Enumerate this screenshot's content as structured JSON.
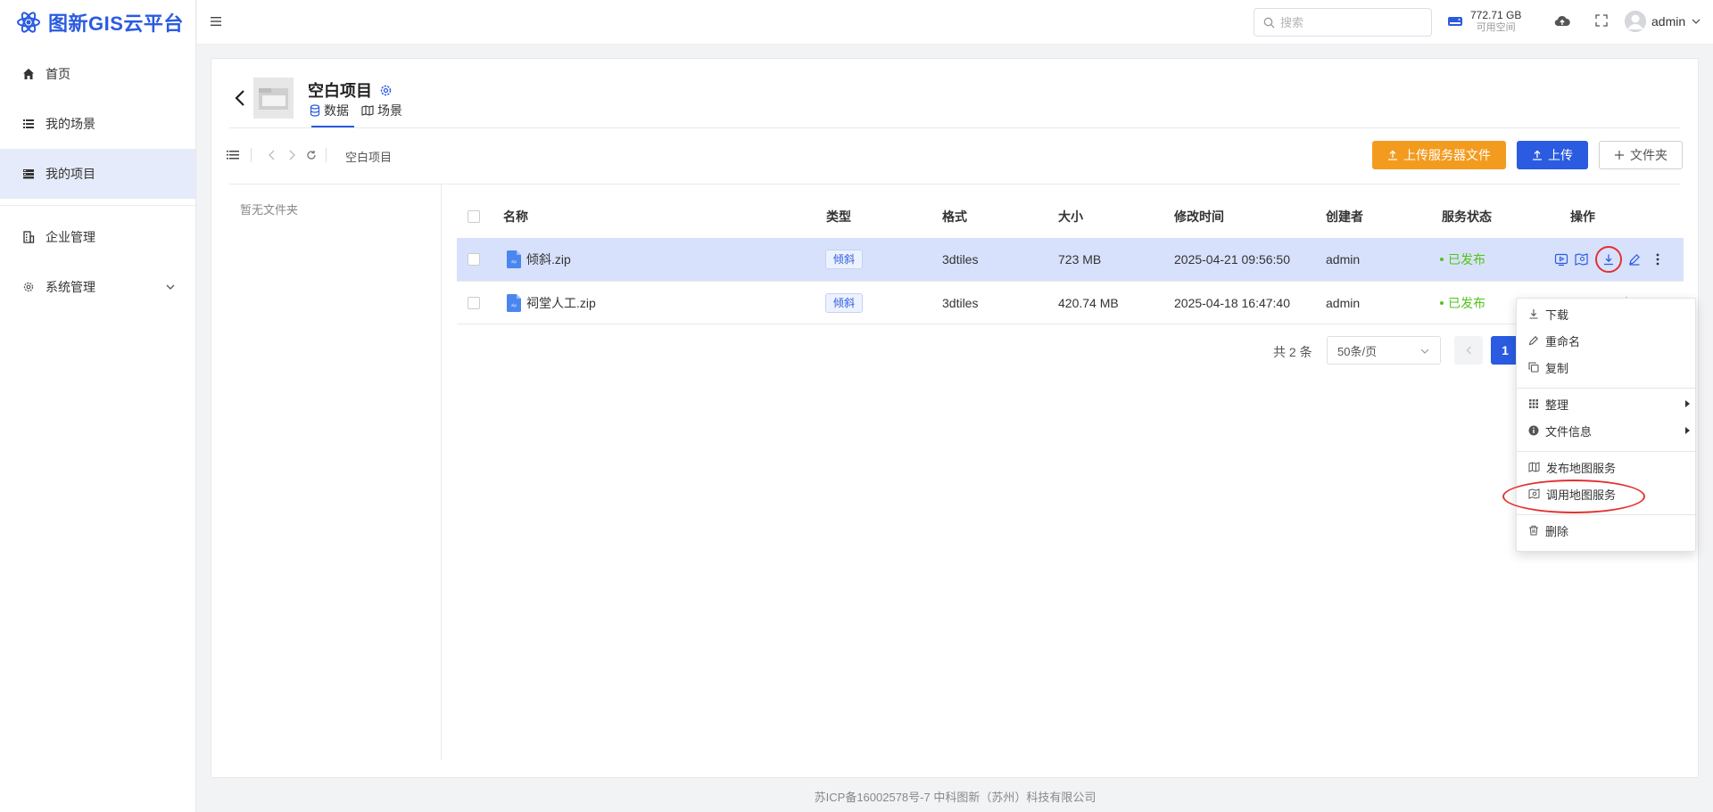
{
  "app": {
    "title": "图新GIS云平台",
    "brand_color": "#2a5be0",
    "icon": "atom-logo-icon"
  },
  "sidebar": {
    "items": [
      {
        "label": "首页",
        "icon": "home-icon"
      },
      {
        "label": "我的场景",
        "icon": "list-icon"
      },
      {
        "label": "我的项目",
        "icon": "project-icon",
        "active": true
      },
      {
        "label": "企业管理",
        "icon": "building-icon"
      },
      {
        "label": "系统管理",
        "icon": "gear-icon",
        "expandable": true
      }
    ]
  },
  "header": {
    "search_placeholder": "搜索",
    "storage_value": "772.71 GB",
    "storage_label": "可用空间",
    "username": "admin"
  },
  "project": {
    "title": "空白项目",
    "tabs": [
      {
        "label": "数据",
        "icon": "database-icon",
        "active": true
      },
      {
        "label": "场景",
        "icon": "map-book-icon"
      }
    ]
  },
  "toolbar": {
    "breadcrumb": "空白项目",
    "upload_server_label": "上传服务器文件",
    "upload_label": "上传",
    "folder_label": "文件夹"
  },
  "folders": {
    "empty_text": "暂无文件夹"
  },
  "table": {
    "columns": [
      "名称",
      "类型",
      "格式",
      "大小",
      "修改时间",
      "创建者",
      "服务状态",
      "操作"
    ],
    "rows": [
      {
        "name": "倾斜.zip",
        "type": "倾斜",
        "format": "3dtiles",
        "size": "723 MB",
        "modified": "2025-04-21 09:56:50",
        "creator": "admin",
        "status": "已发布",
        "selected": true
      },
      {
        "name": "祠堂人工.zip",
        "type": "倾斜",
        "format": "3dtiles",
        "size": "420.74 MB",
        "modified": "2025-04-18 16:47:40",
        "creator": "admin",
        "status": "已发布",
        "selected": false
      }
    ]
  },
  "pagination": {
    "total_text": "共 2 条",
    "page_size": "50条/页",
    "current_page": "1"
  },
  "context_menu": {
    "items": [
      {
        "label": "下载",
        "icon": "download-icon"
      },
      {
        "label": "重命名",
        "icon": "edit-icon"
      },
      {
        "label": "复制",
        "icon": "copy-icon"
      },
      {
        "label": "整理",
        "icon": "grid-icon",
        "submenu": true
      },
      {
        "label": "文件信息",
        "icon": "info-icon",
        "submenu": true
      },
      {
        "label": "发布地图服务",
        "icon": "map-icon"
      },
      {
        "label": "调用地图服务",
        "icon": "map-call-icon"
      },
      {
        "label": "删除",
        "icon": "trash-icon"
      }
    ]
  },
  "footer": {
    "text": "苏ICP备16002578号-7 中科图新（苏州）科技有限公司"
  },
  "colors": {
    "primary": "#2a5be0",
    "orange": "#f39b1f",
    "success": "#52c41a",
    "highlight_ring": "#e2312f",
    "selected_row": "#d8e1fb"
  }
}
